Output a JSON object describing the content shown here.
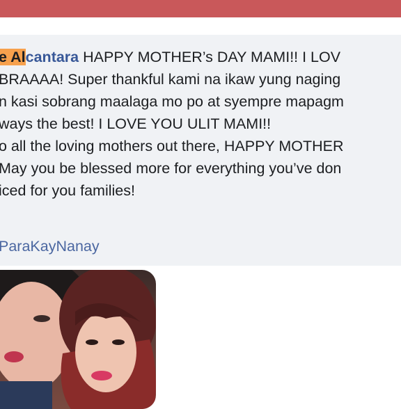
{
  "post": {
    "author_highlight": "e Al",
    "author_rest": "cantara",
    "lines": [
      " HAPPY MOTHER’s DAY MAMI!! I LOV",
      "BRAAAA! Super thankful kami na ikaw yung naging",
      "n kasi sobrang maalaga mo po at syempre mapagm",
      "ways the best! I LOVE YOU ULIT MAMI!!",
      "o all the loving mothers out there, HAPPY MOTHER",
      "May you be blessed more for everything you’ve don",
      "iced for you families!"
    ],
    "hashtag": "ParaKayNanay"
  },
  "colors": {
    "topbar": "#c9585a",
    "bubble": "#f0f2f5",
    "author": "#385898",
    "highlight": "#f7a14d",
    "hashtag": "#4b67a1"
  }
}
